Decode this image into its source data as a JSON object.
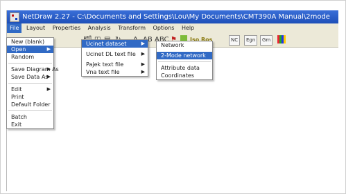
{
  "window": {
    "title": "NetDraw 2.27 - C:\\Documents and Settings\\Lou\\My Documents\\CMT390A Manual\\2mode"
  },
  "menubar": [
    "File",
    "Layout",
    "Properties",
    "Analysis",
    "Transform",
    "Options",
    "Help"
  ],
  "toolbar": {
    "label_a": "A",
    "label_ab": "AB",
    "label_abc": "ABC",
    "label_ikw": "Iso Ros",
    "label_nc": "NC",
    "label_egn": "Egn",
    "label_gm": "Gm"
  },
  "file_menu": {
    "items": [
      "New (blank)",
      "Open",
      "Random",
      "Save Diagram As",
      "Save Data As",
      "Edit",
      "Print",
      "Default Folder",
      "Batch",
      "Exit"
    ]
  },
  "open_submenu": {
    "items": [
      "Ucinet dataset",
      "Ucinet DL text file",
      "Pajek text file",
      "Vna text file"
    ]
  },
  "ucinet_submenu": {
    "items": [
      "Network",
      "2-Mode network",
      "Attribute data",
      "Coordinates"
    ]
  },
  "colors": {
    "titlebar": "#1e4fb8",
    "menubar": "#ece9d8",
    "highlight": "#316ac5"
  }
}
